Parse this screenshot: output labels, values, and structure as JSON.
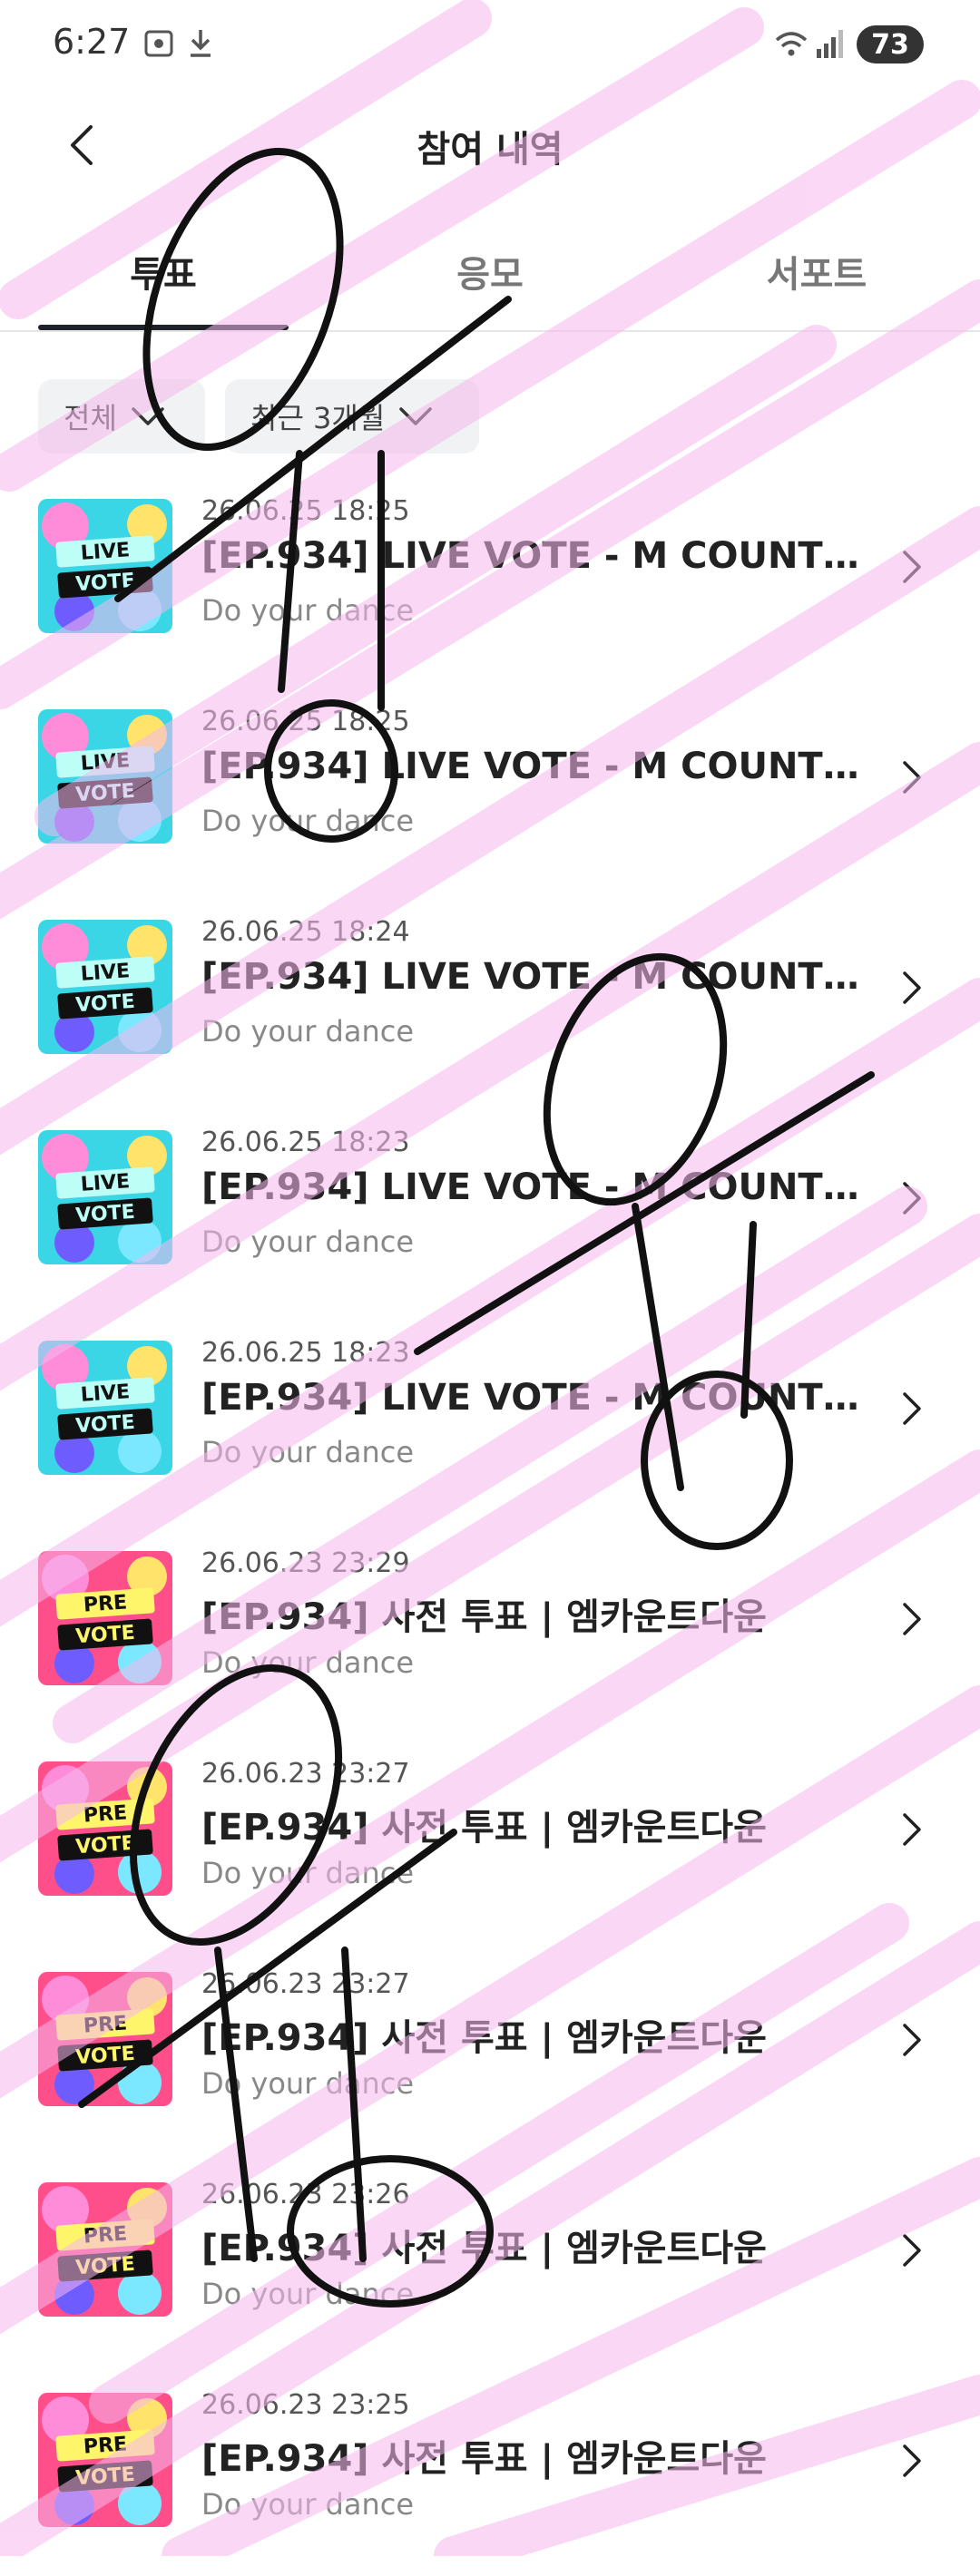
{
  "status_bar": {
    "time": "6:27",
    "battery": "73"
  },
  "header": {
    "title": "참여 내역"
  },
  "tabs": [
    {
      "label": "투표",
      "active": true
    },
    {
      "label": "응모",
      "active": false
    },
    {
      "label": "서포트",
      "active": false
    }
  ],
  "filters": {
    "type": "전체",
    "period": "최근 3개월"
  },
  "items": [
    {
      "date": "26.06.25 18:25",
      "title": "[EP.934] LIVE VOTE - M COUNTDO...",
      "subtitle": "Do your dance",
      "badge_top": "LIVE",
      "badge_bottom": "VOTE"
    },
    {
      "date": "26.06.25 18:25",
      "title": "[EP.934] LIVE VOTE - M COUNTDO...",
      "subtitle": "Do your dance",
      "badge_top": "LIVE",
      "badge_bottom": "VOTE"
    },
    {
      "date": "26.06.25 18:24",
      "title": "[EP.934] LIVE VOTE - M COUNTDO...",
      "subtitle": "Do your dance",
      "badge_top": "LIVE",
      "badge_bottom": "VOTE"
    },
    {
      "date": "26.06.25 18:23",
      "title": "[EP.934] LIVE VOTE - M COUNTDO...",
      "subtitle": "Do your dance",
      "badge_top": "LIVE",
      "badge_bottom": "VOTE"
    },
    {
      "date": "26.06.25 18:23",
      "title": "[EP.934] LIVE VOTE - M COUNTDO...",
      "subtitle": "Do your dance",
      "badge_top": "LIVE",
      "badge_bottom": "VOTE"
    },
    {
      "date": "26.06.23 23:29",
      "title": "[EP.934] 사전 투표 | 엠카운트다운",
      "subtitle": "Do your dance",
      "badge_top": "PRE",
      "badge_bottom": "VOTE"
    },
    {
      "date": "26.06.23 23:27",
      "title": "[EP.934] 사전 투표 | 엠카운트다운",
      "subtitle": "Do your dance",
      "badge_top": "PRE",
      "badge_bottom": "VOTE"
    },
    {
      "date": "26.06.23 23:27",
      "title": "[EP.934] 사전 투표 | 엠카운트다운",
      "subtitle": "Do your dance",
      "badge_top": "PRE",
      "badge_bottom": "VOTE"
    },
    {
      "date": "26.06.23 23:26",
      "title": "[EP.934] 사전 투표 | 엠카운트다운",
      "subtitle": "Do your dance",
      "badge_top": "PRE",
      "badge_bottom": "VOTE"
    },
    {
      "date": "26.06.23 23:25",
      "title": "[EP.934] 사전 투표 | 엠카운트다운",
      "subtitle": "Do your dance",
      "badge_top": "PRE",
      "badge_bottom": "VOTE"
    }
  ],
  "icons": [
    "screenshot-icon",
    "download-icon",
    "wifi-icon",
    "signal-icon",
    "battery-icon",
    "back-arrow-icon",
    "chevron-down-icon",
    "chevron-right-icon"
  ],
  "colors": {
    "pink_overlay": "#f8c6f0",
    "scribble": "#111111",
    "live_bg": "#3ad6e6",
    "pre_bg": "#ff4f8b"
  }
}
